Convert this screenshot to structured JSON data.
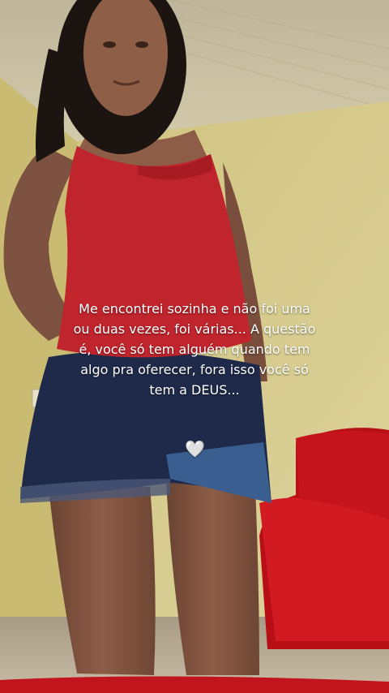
{
  "caption": {
    "lines": [
      "Me encontrei sozinha e não foi uma",
      "ou duas vezes, foi várias... A questão",
      "é, você só tem alguém quando tem",
      "algo pra oferecer, fora isso você só",
      "tem a DEUS..."
    ],
    "emoji": "🤍"
  },
  "scene": {
    "icons": [
      "photo-background"
    ],
    "colors": {
      "wall": "#d9cf93",
      "ceiling": "#cfc6a3",
      "top": "#c0242c",
      "shorts": "#1f2a4a",
      "sofa": "#c8151c",
      "skin": "#8a5a44"
    }
  }
}
